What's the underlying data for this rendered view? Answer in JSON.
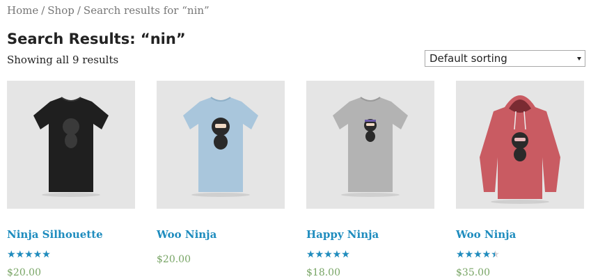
{
  "breadcrumb": {
    "home": "Home",
    "shop": "Shop",
    "current": "Search results for “nin”",
    "separator": "/"
  },
  "page_title": "Search Results: “nin”",
  "result_count": "Showing all 9 results",
  "sorting": {
    "selected": "Default sorting"
  },
  "colors": {
    "link": "#1e8cbe",
    "price": "#77a464",
    "thumb_bg": "#e5e5e5"
  },
  "products": [
    {
      "title": "Ninja Silhouette",
      "price": "$20.00",
      "rating": 5,
      "has_rating": true,
      "image": "black-tshirt-ninja-silhouette",
      "shirt_color": "#1f1f1f"
    },
    {
      "title": "Woo Ninja",
      "price": "$20.00",
      "rating": 0,
      "has_rating": false,
      "image": "light-blue-tshirt-woo-ninja",
      "shirt_color": "#a9c6dc"
    },
    {
      "title": "Happy Ninja",
      "price": "$18.00",
      "rating": 5,
      "has_rating": true,
      "image": "grey-tshirt-happy-ninja",
      "shirt_color": "#b3b3b3"
    },
    {
      "title": "Woo Ninja",
      "price": "$35.00",
      "rating": 4.5,
      "has_rating": true,
      "image": "red-hoodie-woo-ninja",
      "shirt_color": "#c95b62"
    }
  ]
}
